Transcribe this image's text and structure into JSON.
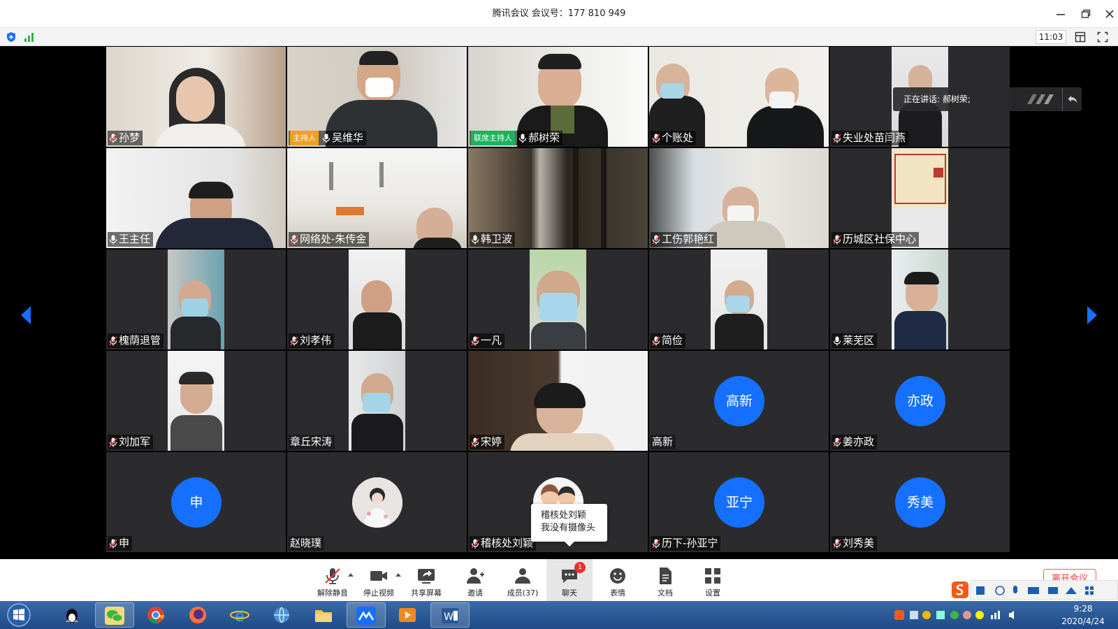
{
  "window": {
    "title": "腾讯会议  会议号：177 810 949",
    "clock": "11:03"
  },
  "speaking": {
    "text": "正在讲话: 郝树荣;"
  },
  "tiles": [
    {
      "name": "孙梦",
      "mic": "muted",
      "kind": "video"
    },
    {
      "name": "吴维华",
      "mic": "on",
      "kind": "video",
      "role": "主持人"
    },
    {
      "name": "郝树荣",
      "mic": "on",
      "kind": "video",
      "role": "联席主持人"
    },
    {
      "name": "个账处",
      "mic": "muted",
      "kind": "video"
    },
    {
      "name": "失业处苗闫燕",
      "mic": "muted",
      "kind": "video"
    },
    {
      "name": "王主任",
      "mic": "on",
      "kind": "video"
    },
    {
      "name": "网络处-朱传金",
      "mic": "muted",
      "kind": "video"
    },
    {
      "name": "韩卫波",
      "mic": "on",
      "kind": "video"
    },
    {
      "name": "工伤郭艳红",
      "mic": "muted",
      "kind": "video"
    },
    {
      "name": "历城区社保中心",
      "mic": "muted",
      "kind": "video"
    },
    {
      "name": "槐荫退管",
      "mic": "muted",
      "kind": "video"
    },
    {
      "name": "刘孝伟",
      "mic": "muted",
      "kind": "video"
    },
    {
      "name": "一凡",
      "mic": "muted",
      "kind": "video"
    },
    {
      "name": "简俭",
      "mic": "muted",
      "kind": "video"
    },
    {
      "name": "莱芜区",
      "mic": "on",
      "kind": "video"
    },
    {
      "name": "刘加军",
      "mic": "muted",
      "kind": "video"
    },
    {
      "name": "章丘宋涛",
      "mic": "none",
      "kind": "video"
    },
    {
      "name": "宋婷",
      "mic": "muted",
      "kind": "video"
    },
    {
      "name": "高新",
      "mic": "none",
      "kind": "avatar",
      "avatar": "高新"
    },
    {
      "name": "姜亦政",
      "mic": "muted",
      "kind": "avatar",
      "avatar": "亦政"
    },
    {
      "name": "申",
      "mic": "muted",
      "kind": "avatar",
      "avatar": "申"
    },
    {
      "name": "赵晓璞",
      "mic": "none",
      "kind": "photo"
    },
    {
      "name": "稽核处刘颖",
      "mic": "muted",
      "kind": "photo"
    },
    {
      "name": "历下-孙亚宁",
      "mic": "muted",
      "kind": "avatar",
      "avatar": "亚宁"
    },
    {
      "name": "刘秀美",
      "mic": "muted",
      "kind": "avatar",
      "avatar": "秀美"
    }
  ],
  "tooltip": {
    "line1": "稽核处刘颖",
    "line2": "我没有摄像头"
  },
  "toolbar": {
    "unmute": "解除静音",
    "stop_video": "停止视频",
    "share": "共享屏幕",
    "invite": "邀请",
    "members": "成员(37)",
    "chat": "聊天",
    "chat_badge": "1",
    "reactions": "表情",
    "docs": "文档",
    "settings": "设置",
    "leave": "离开会议"
  },
  "taskbar": {
    "time": "9:28",
    "date": "2020/4/24"
  },
  "colors": {
    "accent_blue": "#1670ff",
    "host_badge": "#f0a020",
    "cohost_badge": "#19b35b",
    "tile_bg": "#2b2b2e",
    "badge_red": "#f02c2c"
  }
}
